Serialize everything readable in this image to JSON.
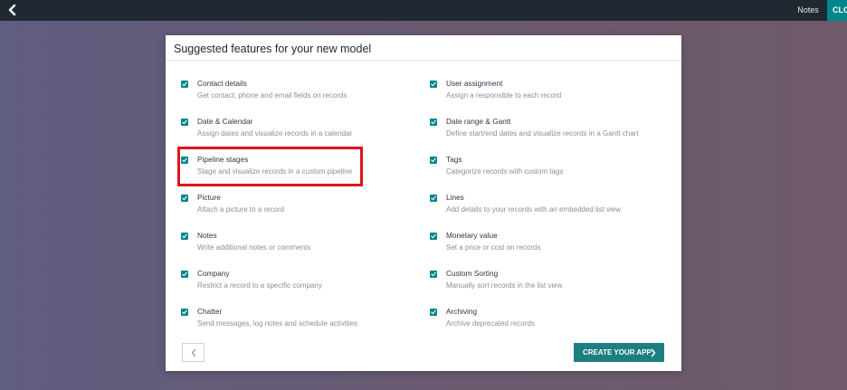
{
  "topbar": {
    "notes_label": "Notes",
    "close_label": "CLOSE",
    "back_icon": "chevron-left-icon"
  },
  "dialog": {
    "title": "Suggested features for your new model",
    "prev_icon": "chevron-left-icon",
    "create_label": "CREATE YOUR APP",
    "create_icon": "chevron-right-icon"
  },
  "features": [
    {
      "name": "Contact details",
      "desc": "Get contact, phone and email fields on records",
      "checked": true
    },
    {
      "name": "User assignment",
      "desc": "Assign a responsible to each record",
      "checked": true
    },
    {
      "name": "Date & Calendar",
      "desc": "Assign dates and visualize records in a calendar",
      "checked": true
    },
    {
      "name": "Date range & Gantt",
      "desc": "Define start/end dates and visualize records in a Gantt chart",
      "checked": true
    },
    {
      "name": "Pipeline stages",
      "desc": "Stage and visualize records in a custom pipeline",
      "checked": true
    },
    {
      "name": "Tags",
      "desc": "Categorize records with custom tags",
      "checked": true
    },
    {
      "name": "Picture",
      "desc": "Attach a picture to a record",
      "checked": true
    },
    {
      "name": "Lines",
      "desc": "Add details to your records with an embedded list view",
      "checked": true
    },
    {
      "name": "Notes",
      "desc": "Write additional notes or comments",
      "checked": true
    },
    {
      "name": "Monetary value",
      "desc": "Set a price or cost on records",
      "checked": true
    },
    {
      "name": "Company",
      "desc": "Restrict a record to a specific company",
      "checked": true
    },
    {
      "name": "Custom Sorting",
      "desc": "Manually sort records in the list view",
      "checked": true
    },
    {
      "name": "Chatter",
      "desc": "Send messages, log notes and schedule activities",
      "checked": true
    },
    {
      "name": "Archiving",
      "desc": "Archive deprecated records",
      "checked": true
    }
  ],
  "colors": {
    "accent": "#00868a",
    "highlight": "#e0141c"
  }
}
